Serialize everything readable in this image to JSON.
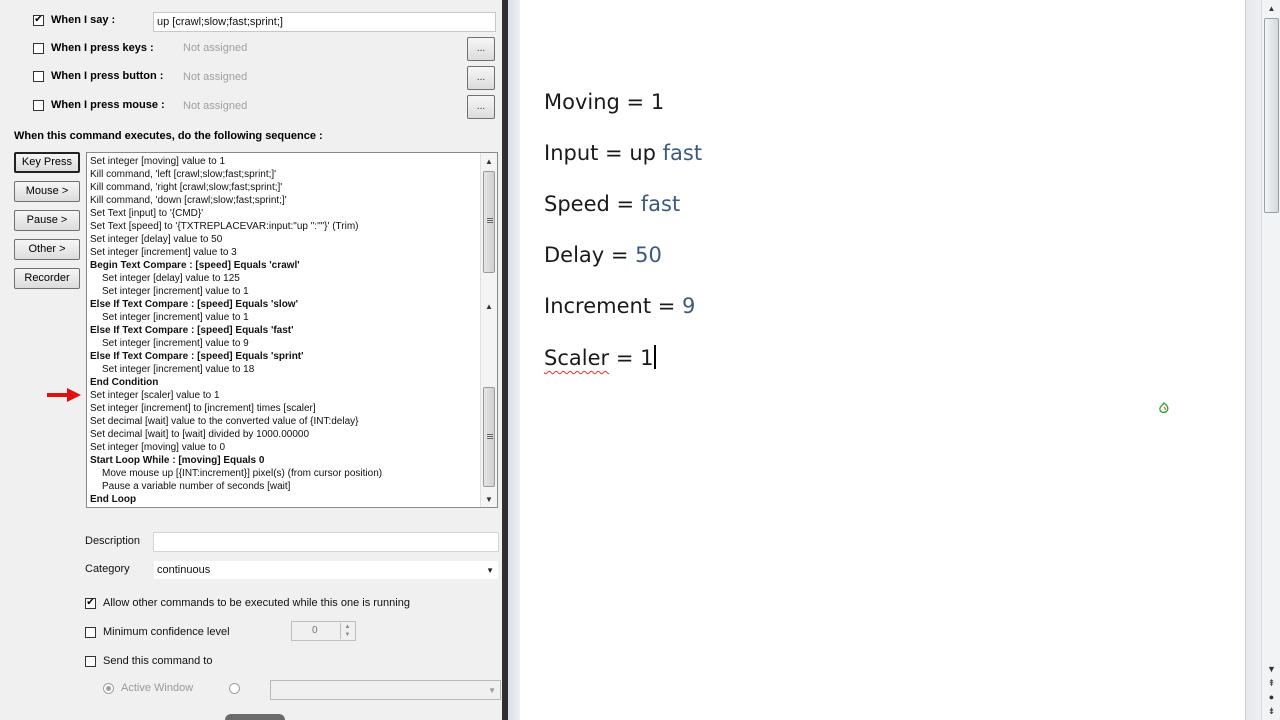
{
  "triggers": {
    "say": {
      "label": "When I say :",
      "checked": true,
      "value": "up [crawl;slow;fast;sprint;]"
    },
    "keys": {
      "label": "When I press keys :",
      "checked": false,
      "value": "Not assigned",
      "button": "..."
    },
    "button": {
      "label": "When I press button :",
      "checked": false,
      "value": "Not assigned",
      "button": "..."
    },
    "mouse": {
      "label": "When I press mouse :",
      "checked": false,
      "value": "Not assigned",
      "button": "..."
    }
  },
  "sequence_title": "When this command executes, do the following sequence :",
  "action_buttons": [
    "Key Press",
    "Mouse >",
    "Pause >",
    "Other >",
    "Recorder"
  ],
  "sequence": [
    {
      "text": "Set integer [moving] value to 1",
      "style": "n"
    },
    {
      "text": "Kill command, 'left [crawl;slow;fast;sprint;]'",
      "style": "n"
    },
    {
      "text": "Kill command, 'right [crawl;slow;fast;sprint;]'",
      "style": "n"
    },
    {
      "text": "Kill command, 'down [crawl;slow;fast;sprint;]'",
      "style": "n"
    },
    {
      "text": "Set Text [input] to '{CMD}'",
      "style": "n"
    },
    {
      "text": "Set Text [speed] to '{TXTREPLACEVAR:input:\"up \":\"\"}' (Trim)",
      "style": "n"
    },
    {
      "text": "Set integer [delay] value to 50",
      "style": "n"
    },
    {
      "text": "Set integer [increment] value to 3",
      "style": "n"
    },
    {
      "text": "Begin Text Compare : [speed] Equals 'crawl'",
      "style": "b"
    },
    {
      "text": "Set integer [delay] value to 125",
      "style": "i"
    },
    {
      "text": "Set integer [increment] value to 1",
      "style": "i"
    },
    {
      "text": "Else If Text Compare : [speed] Equals 'slow'",
      "style": "b"
    },
    {
      "text": "Set integer [increment] value to 1",
      "style": "i"
    },
    {
      "text": "Else If Text Compare : [speed] Equals 'fast'",
      "style": "b"
    },
    {
      "text": "Set integer [increment] value to 9",
      "style": "i"
    },
    {
      "text": "Else If Text Compare : [speed] Equals 'sprint'",
      "style": "b"
    },
    {
      "text": "Set integer [increment] value to 18",
      "style": "i"
    },
    {
      "text": "End Condition",
      "style": "b"
    },
    {
      "text": "Set integer [scaler] value to 1",
      "style": "n"
    },
    {
      "text": "Set integer [increment] to [increment] times [scaler]",
      "style": "n"
    },
    {
      "text": "Set decimal [wait] value to the converted value of {INT:delay}",
      "style": "n"
    },
    {
      "text": "Set decimal [wait] to [wait] divided by 1000.00000",
      "style": "n"
    },
    {
      "text": "Set integer [moving] value to 0",
      "style": "n"
    },
    {
      "text": "Start Loop While : [moving] Equals 0",
      "style": "b"
    },
    {
      "text": "Move mouse up [{INT:increment}] pixel(s) (from cursor position)",
      "style": "i"
    },
    {
      "text": "Pause a variable number of seconds [wait]",
      "style": "i"
    },
    {
      "text": "End Loop",
      "style": "b"
    }
  ],
  "description": {
    "label": "Description",
    "value": ""
  },
  "category": {
    "label": "Category",
    "value": "continuous"
  },
  "options": {
    "allow_other": {
      "label": "Allow other commands to be executed while this one is running",
      "checked": true
    },
    "min_confidence": {
      "label": "Minimum confidence level",
      "checked": false,
      "value": "0"
    },
    "send_to": {
      "label": "Send this command to",
      "checked": false
    }
  },
  "send_target": {
    "active_window": "Active Window",
    "selected": "active_window"
  },
  "document": {
    "lines": [
      {
        "label": "Moving = ",
        "value": "1",
        "value_style": "plain"
      },
      {
        "label": "Input = up ",
        "value": "fast",
        "value_style": "accent"
      },
      {
        "label": "Speed = ",
        "value": "fast",
        "value_style": "accent"
      },
      {
        "label": "Delay = ",
        "value": "50",
        "value_style": "accent"
      },
      {
        "label": "Increment = ",
        "value": "9",
        "value_style": "accent"
      },
      {
        "label": "Scaler",
        "value": " = 1",
        "value_style": "plain"
      }
    ]
  },
  "colors": {
    "accent": "#3c5a80",
    "dialog_bg": "#f0f0f0",
    "arrow": "#e01010"
  },
  "icons": {
    "scroll_up": "▲",
    "scroll_down": "▼",
    "dropdown": "▼",
    "check": "✔"
  }
}
